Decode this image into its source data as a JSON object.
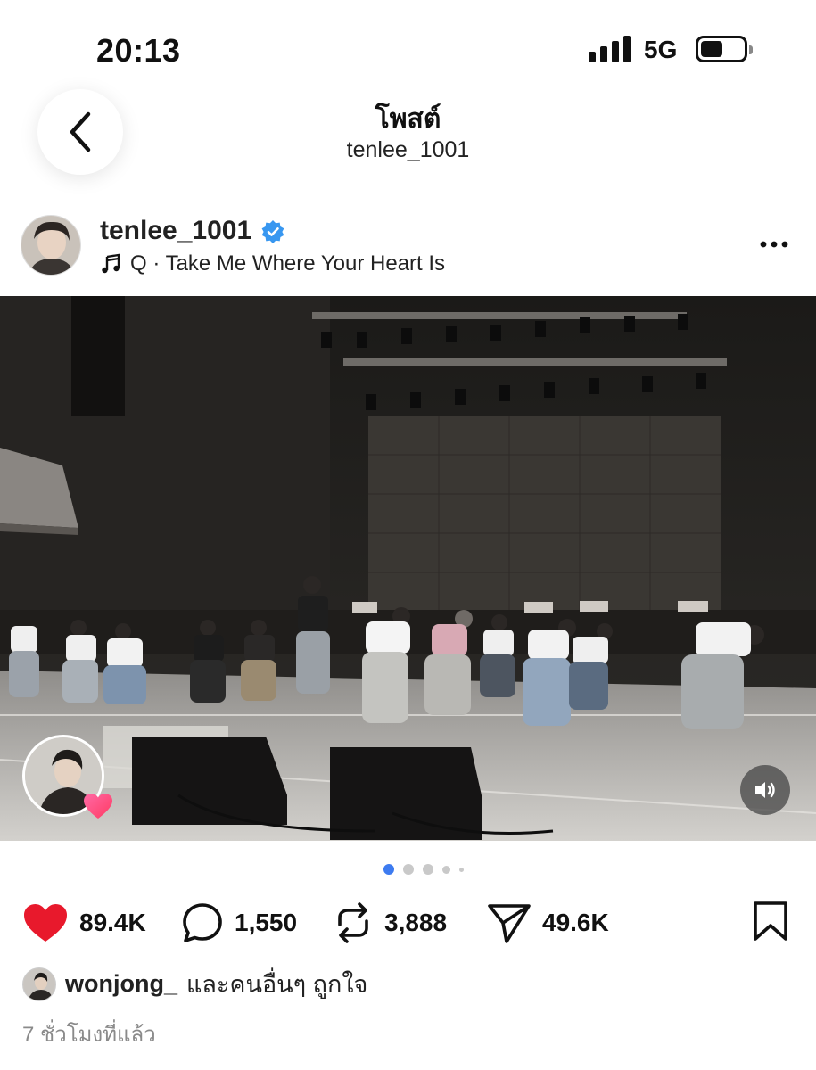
{
  "status_bar": {
    "time": "20:13",
    "network": "5G",
    "battery_level": 0.4
  },
  "header": {
    "title": "โพสต์",
    "subtitle": "tenlee_1001"
  },
  "post": {
    "username": "tenlee_1001",
    "verified": true,
    "music": "Q · Take Me Where Your Heart Is",
    "carousel": {
      "count": 5,
      "active_index": 0
    }
  },
  "actions": {
    "likes": "89.4K",
    "comments": "1,550",
    "reposts": "3,888",
    "shares": "49.6K"
  },
  "liked_by": {
    "user": "wonjong_",
    "text": "และคนอื่นๆ ถูกใจ"
  },
  "time_ago": "7 ชั่วโมงที่แล้ว",
  "colors": {
    "like": "#e8192c",
    "dot_active": "#3d7bf0",
    "dot_inactive": "#c9c9c9",
    "verified": "#3897f0"
  },
  "icons": [
    "back-icon",
    "verified-icon",
    "music-note-icon",
    "more-icon",
    "volume-icon",
    "heart-icon",
    "comment-icon",
    "repost-icon",
    "share-icon",
    "bookmark-icon"
  ]
}
